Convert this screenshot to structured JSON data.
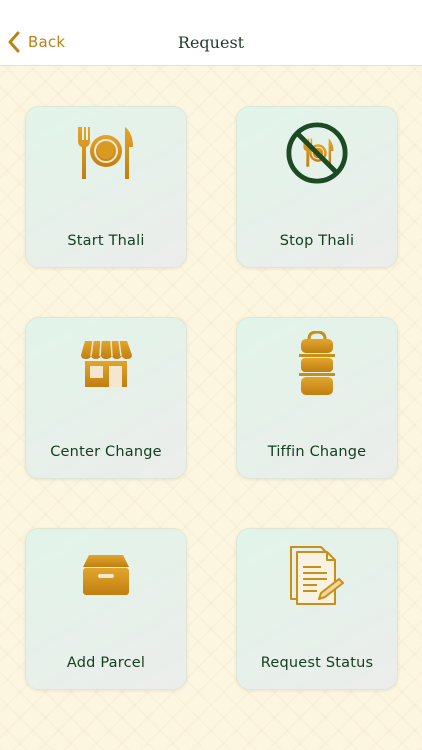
{
  "header": {
    "back_label": "Back",
    "title": "Request"
  },
  "colors": {
    "accent": "#c4901b",
    "label": "#15401f",
    "stop_ring": "#1c4a23"
  },
  "cards": [
    {
      "label": "Start Thali",
      "icon": "plate-fork-knife-icon"
    },
    {
      "label": "Stop Thali",
      "icon": "no-meal-icon"
    },
    {
      "label": "Center Change",
      "icon": "storefront-icon"
    },
    {
      "label": "Tiffin Change",
      "icon": "tiffin-box-icon"
    },
    {
      "label": "Add Parcel",
      "icon": "parcel-box-icon"
    },
    {
      "label": "Request Status",
      "icon": "document-list-icon"
    }
  ]
}
